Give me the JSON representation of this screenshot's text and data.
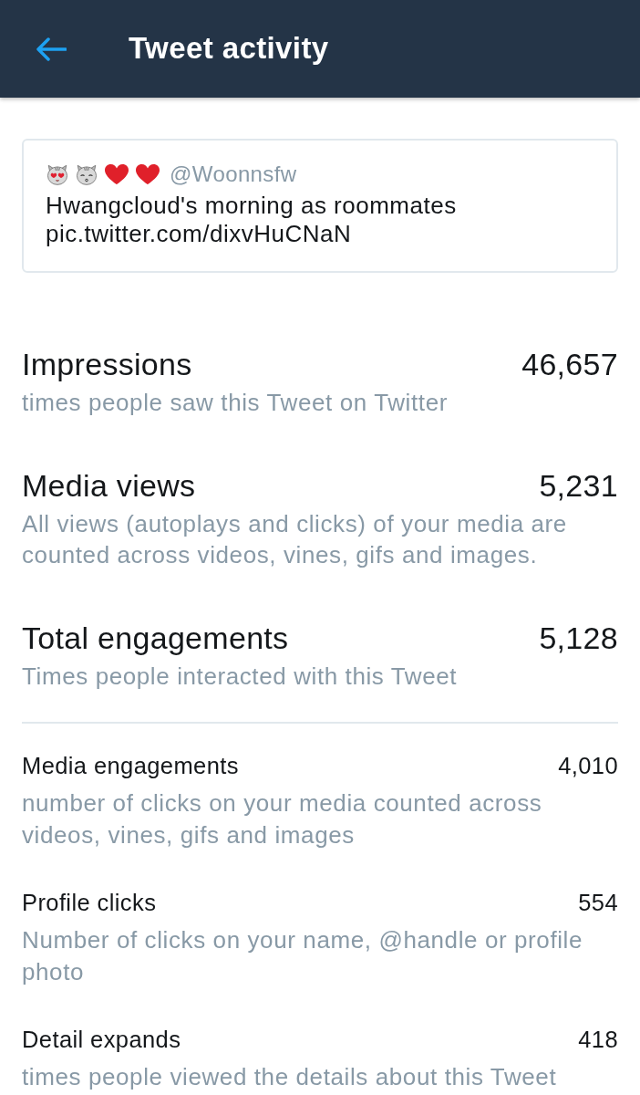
{
  "header": {
    "title": "Tweet activity"
  },
  "tweet": {
    "handle": "@Woonnsfw",
    "text": "Hwangcloud's morning as roommates pic.twitter.com/dixvHuCNaN"
  },
  "summary": [
    {
      "label": "Impressions",
      "value": "46,657",
      "description": "times people saw this Tweet on Twitter"
    },
    {
      "label": "Media views",
      "value": "5,231",
      "description": "All views (autoplays and clicks) of your media are counted across videos, vines, gifs and images."
    },
    {
      "label": "Total engagements",
      "value": "5,128",
      "description": "Times people interacted with this Tweet"
    }
  ],
  "details": [
    {
      "label": "Media engagements",
      "value": "4,010",
      "description": "number of clicks on your media counted across videos, vines, gifs and images"
    },
    {
      "label": "Profile clicks",
      "value": "554",
      "description": "Number of clicks on your name, @handle or profile photo"
    },
    {
      "label": "Detail expands",
      "value": "418",
      "description": "times people viewed the details about this Tweet"
    }
  ]
}
